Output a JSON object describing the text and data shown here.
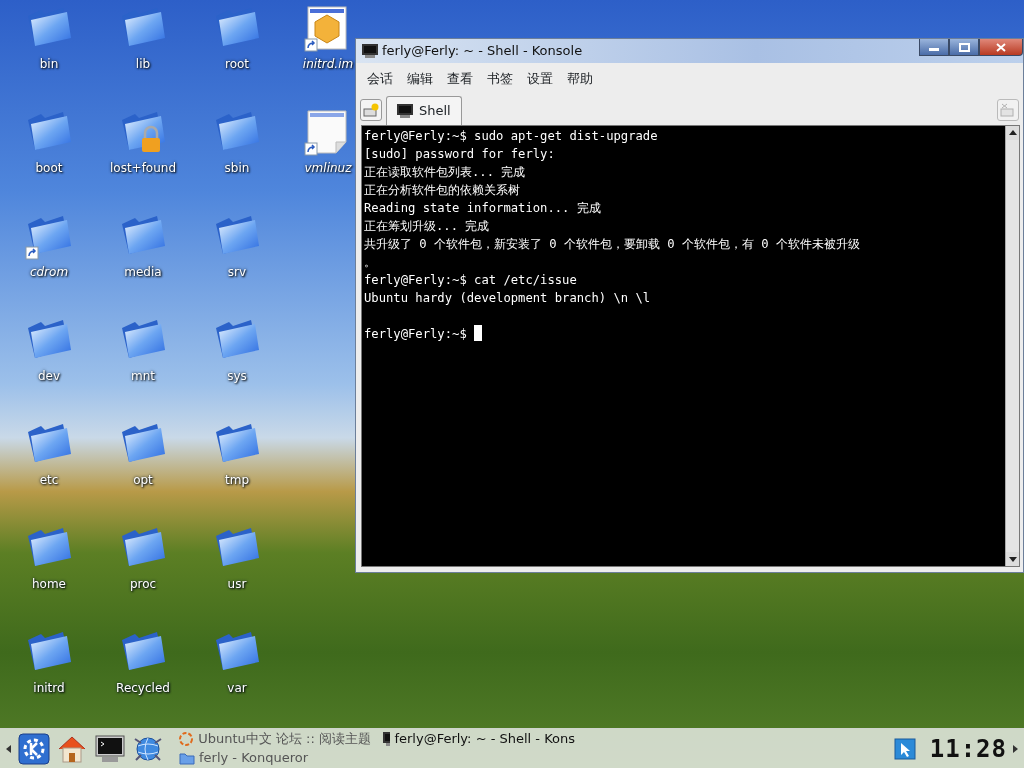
{
  "desktop_rows": [
    [
      {
        "label": "bin",
        "kind": "folder"
      },
      {
        "label": "lib",
        "kind": "folder"
      },
      {
        "label": "root",
        "kind": "folder"
      },
      {
        "label": "initrd.im",
        "kind": "package",
        "link": true
      }
    ],
    [
      {
        "label": "boot",
        "kind": "folder"
      },
      {
        "label": "lost+found",
        "kind": "folder",
        "locked": true
      },
      {
        "label": "sbin",
        "kind": "folder"
      },
      {
        "label": "vmlinuz",
        "kind": "file",
        "link": true
      }
    ],
    [
      {
        "label": "cdrom",
        "kind": "folder",
        "link": true
      },
      {
        "label": "media",
        "kind": "folder"
      },
      {
        "label": "srv",
        "kind": "folder"
      }
    ],
    [
      {
        "label": "dev",
        "kind": "folder"
      },
      {
        "label": "mnt",
        "kind": "folder"
      },
      {
        "label": "sys",
        "kind": "folder"
      }
    ],
    [
      {
        "label": "etc",
        "kind": "folder"
      },
      {
        "label": "opt",
        "kind": "folder"
      },
      {
        "label": "tmp",
        "kind": "folder"
      }
    ],
    [
      {
        "label": "home",
        "kind": "folder"
      },
      {
        "label": "proc",
        "kind": "folder"
      },
      {
        "label": "usr",
        "kind": "folder"
      }
    ],
    [
      {
        "label": "initrd",
        "kind": "folder"
      },
      {
        "label": "Recycled",
        "kind": "folder"
      },
      {
        "label": "var",
        "kind": "folder"
      }
    ]
  ],
  "window": {
    "title": "ferly@Ferly: ~ - Shell - Konsole",
    "menu": [
      "会话",
      "编辑",
      "查看",
      "书签",
      "设置",
      "帮助"
    ],
    "tabs": [
      {
        "label": "Shell",
        "selected": true
      }
    ],
    "terminal_lines": [
      {
        "text": "ferly@Ferly:~$ sudo apt-get dist-upgrade"
      },
      {
        "text": "[sudo] password for ferly:"
      },
      {
        "text": "正在读取软件包列表... 完成"
      },
      {
        "text": "正在分析软件包的依赖关系树"
      },
      {
        "text": "Reading state information... 完成"
      },
      {
        "text": "正在筹划升级... 完成"
      },
      {
        "text": "共升级了 0 个软件包，新安装了 0 个软件包，要卸载 0 个软件包，有 0 个软件未被升级"
      },
      {
        "text": "。"
      },
      {
        "text": "ferly@Ferly:~$ cat /etc/issue"
      },
      {
        "text": "Ubuntu hardy (development branch) \\n \\l"
      },
      {
        "text": "ferly@Ferly:~$",
        "blank_line_before": true,
        "cursor": true
      }
    ]
  },
  "taskbar": {
    "launchers": [
      {
        "kind": "kmenu"
      },
      {
        "kind": "home"
      },
      {
        "kind": "terminal"
      },
      {
        "kind": "browser"
      }
    ],
    "tasks": [
      {
        "label": "Ubuntu中文 论坛 :: 阅读主题",
        "kind": "web",
        "active": false
      },
      {
        "label": "ferly@Ferly: ~ - Shell - Kons",
        "kind": "terminal",
        "active": true
      },
      {
        "label": "ferly - Konqueror",
        "kind": "folder",
        "active": false
      }
    ],
    "clock": "11:28"
  }
}
